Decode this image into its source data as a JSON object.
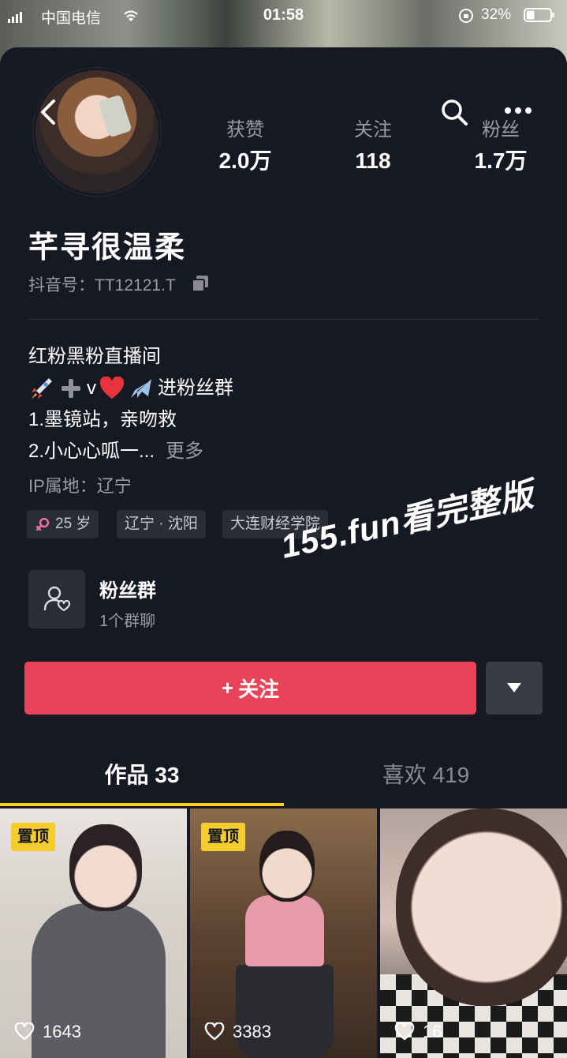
{
  "status_bar": {
    "carrier": "中国电信",
    "time": "01:58",
    "battery": "32%"
  },
  "profile": {
    "nickname": "芊寻很温柔",
    "douyin_id": "抖音号：TT12121.T",
    "stats": [
      {
        "label": "获赞",
        "value": "2.0万"
      },
      {
        "label": "关注",
        "value": "118"
      },
      {
        "label": "粉丝",
        "value": "1.7万"
      }
    ],
    "bio": {
      "line1": "红粉黑粉直播间",
      "line2_text": "v",
      "line2_suffix": "进粉丝群",
      "line3": "1.墨镜站，亲吻救",
      "line4": "2.小心心呱一...",
      "more": "更多"
    },
    "ip": "IP属地：辽宁",
    "tags": [
      {
        "label": "25 岁",
        "icon": "female-icon"
      },
      {
        "label": "辽宁 · 沈阳"
      },
      {
        "label": "大连财经学院"
      }
    ]
  },
  "fans_group": {
    "title": "粉丝群",
    "subtitle": "1个群聊"
  },
  "watermark": "155.fun看完整版",
  "actions": {
    "follow_label": "关注",
    "follow_icon": "+"
  },
  "tabs": [
    {
      "label": "作品 33",
      "active": true
    },
    {
      "label": "喜欢 419",
      "active": false
    }
  ],
  "videos": [
    {
      "pinned": true,
      "pin_label": "置顶",
      "likes": "1643"
    },
    {
      "pinned": true,
      "pin_label": "置顶",
      "likes": "3383"
    },
    {
      "pinned": false,
      "likes": "16"
    }
  ],
  "colors": {
    "background": "#161823",
    "follow_button": "#e94359",
    "tab_underline": "#face15",
    "pin_badge": "#f5cd2e"
  }
}
